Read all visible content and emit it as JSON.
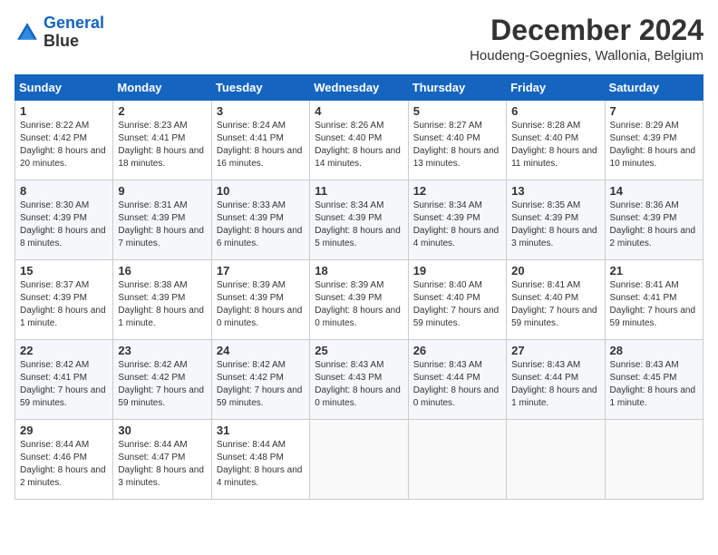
{
  "header": {
    "logo_line1": "General",
    "logo_line2": "Blue",
    "month": "December 2024",
    "location": "Houdeng-Goegnies, Wallonia, Belgium"
  },
  "weekdays": [
    "Sunday",
    "Monday",
    "Tuesday",
    "Wednesday",
    "Thursday",
    "Friday",
    "Saturday"
  ],
  "weeks": [
    [
      {
        "day": "1",
        "sunrise": "8:22 AM",
        "sunset": "4:42 PM",
        "daylight": "8 hours and 20 minutes."
      },
      {
        "day": "2",
        "sunrise": "8:23 AM",
        "sunset": "4:41 PM",
        "daylight": "8 hours and 18 minutes."
      },
      {
        "day": "3",
        "sunrise": "8:24 AM",
        "sunset": "4:41 PM",
        "daylight": "8 hours and 16 minutes."
      },
      {
        "day": "4",
        "sunrise": "8:26 AM",
        "sunset": "4:40 PM",
        "daylight": "8 hours and 14 minutes."
      },
      {
        "day": "5",
        "sunrise": "8:27 AM",
        "sunset": "4:40 PM",
        "daylight": "8 hours and 13 minutes."
      },
      {
        "day": "6",
        "sunrise": "8:28 AM",
        "sunset": "4:40 PM",
        "daylight": "8 hours and 11 minutes."
      },
      {
        "day": "7",
        "sunrise": "8:29 AM",
        "sunset": "4:39 PM",
        "daylight": "8 hours and 10 minutes."
      }
    ],
    [
      {
        "day": "8",
        "sunrise": "8:30 AM",
        "sunset": "4:39 PM",
        "daylight": "8 hours and 8 minutes."
      },
      {
        "day": "9",
        "sunrise": "8:31 AM",
        "sunset": "4:39 PM",
        "daylight": "8 hours and 7 minutes."
      },
      {
        "day": "10",
        "sunrise": "8:33 AM",
        "sunset": "4:39 PM",
        "daylight": "8 hours and 6 minutes."
      },
      {
        "day": "11",
        "sunrise": "8:34 AM",
        "sunset": "4:39 PM",
        "daylight": "8 hours and 5 minutes."
      },
      {
        "day": "12",
        "sunrise": "8:34 AM",
        "sunset": "4:39 PM",
        "daylight": "8 hours and 4 minutes."
      },
      {
        "day": "13",
        "sunrise": "8:35 AM",
        "sunset": "4:39 PM",
        "daylight": "8 hours and 3 minutes."
      },
      {
        "day": "14",
        "sunrise": "8:36 AM",
        "sunset": "4:39 PM",
        "daylight": "8 hours and 2 minutes."
      }
    ],
    [
      {
        "day": "15",
        "sunrise": "8:37 AM",
        "sunset": "4:39 PM",
        "daylight": "8 hours and 1 minute."
      },
      {
        "day": "16",
        "sunrise": "8:38 AM",
        "sunset": "4:39 PM",
        "daylight": "8 hours and 1 minute."
      },
      {
        "day": "17",
        "sunrise": "8:39 AM",
        "sunset": "4:39 PM",
        "daylight": "8 hours and 0 minutes."
      },
      {
        "day": "18",
        "sunrise": "8:39 AM",
        "sunset": "4:39 PM",
        "daylight": "8 hours and 0 minutes."
      },
      {
        "day": "19",
        "sunrise": "8:40 AM",
        "sunset": "4:40 PM",
        "daylight": "7 hours and 59 minutes."
      },
      {
        "day": "20",
        "sunrise": "8:41 AM",
        "sunset": "4:40 PM",
        "daylight": "7 hours and 59 minutes."
      },
      {
        "day": "21",
        "sunrise": "8:41 AM",
        "sunset": "4:41 PM",
        "daylight": "7 hours and 59 minutes."
      }
    ],
    [
      {
        "day": "22",
        "sunrise": "8:42 AM",
        "sunset": "4:41 PM",
        "daylight": "7 hours and 59 minutes."
      },
      {
        "day": "23",
        "sunrise": "8:42 AM",
        "sunset": "4:42 PM",
        "daylight": "7 hours and 59 minutes."
      },
      {
        "day": "24",
        "sunrise": "8:42 AM",
        "sunset": "4:42 PM",
        "daylight": "7 hours and 59 minutes."
      },
      {
        "day": "25",
        "sunrise": "8:43 AM",
        "sunset": "4:43 PM",
        "daylight": "8 hours and 0 minutes."
      },
      {
        "day": "26",
        "sunrise": "8:43 AM",
        "sunset": "4:44 PM",
        "daylight": "8 hours and 0 minutes."
      },
      {
        "day": "27",
        "sunrise": "8:43 AM",
        "sunset": "4:44 PM",
        "daylight": "8 hours and 1 minute."
      },
      {
        "day": "28",
        "sunrise": "8:43 AM",
        "sunset": "4:45 PM",
        "daylight": "8 hours and 1 minute."
      }
    ],
    [
      {
        "day": "29",
        "sunrise": "8:44 AM",
        "sunset": "4:46 PM",
        "daylight": "8 hours and 2 minutes."
      },
      {
        "day": "30",
        "sunrise": "8:44 AM",
        "sunset": "4:47 PM",
        "daylight": "8 hours and 3 minutes."
      },
      {
        "day": "31",
        "sunrise": "8:44 AM",
        "sunset": "4:48 PM",
        "daylight": "8 hours and 4 minutes."
      },
      null,
      null,
      null,
      null
    ]
  ]
}
